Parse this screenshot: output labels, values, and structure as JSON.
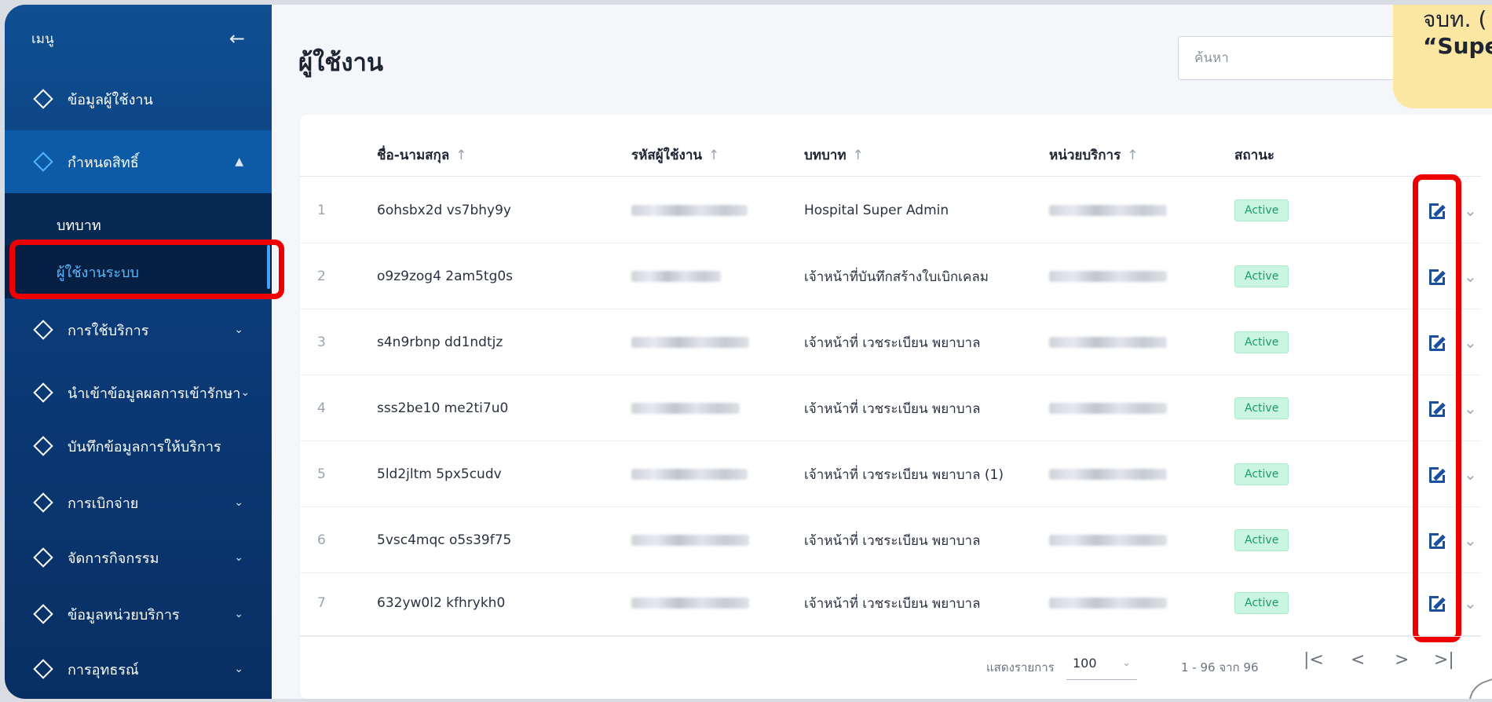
{
  "sidebar": {
    "title": "เมนู",
    "items": [
      {
        "label": "ข้อมูลผู้ใช้งาน",
        "chevron": ""
      },
      {
        "label": "กำหนดสิทธิ์",
        "chevron": "^"
      },
      {
        "label": "บทบาท",
        "chevron": ""
      },
      {
        "label": "ผู้ใช้งานระบบ",
        "chevron": ""
      },
      {
        "label": "การใช้บริการ",
        "chevron": "v"
      },
      {
        "label": "นำเข้าข้อมูลผลการเข้ารักษา",
        "chevron": "v"
      },
      {
        "label": "บันทึกข้อมูลการให้บริการ",
        "chevron": ""
      },
      {
        "label": "การเบิกจ่าย",
        "chevron": "v"
      },
      {
        "label": "จัดการกิจกรรม",
        "chevron": "v"
      },
      {
        "label": "ข้อมูลหน่วยบริการ",
        "chevron": "v"
      },
      {
        "label": "การอุทธรณ์",
        "chevron": "v"
      }
    ]
  },
  "header": {
    "title": "ผู้ใช้งาน",
    "search_placeholder": "ค้นหา",
    "tooltip_line1": "จบท. (",
    "tooltip_line2": "“Supe"
  },
  "table": {
    "columns": [
      "ชื่อ-นามสกุล",
      "รหัสผู้ใช้งาน",
      "บทบาท",
      "หน่วยบริการ",
      "สถานะ"
    ],
    "rows": [
      {
        "num": "1",
        "name": "6ohsbx2d vs7bhy9y",
        "role": "Hospital Super Admin",
        "status": "Active"
      },
      {
        "num": "2",
        "name": "o9z9zog4 2am5tg0s",
        "role": "เจ้าหน้าที่บันทึกสร้างใบเบิกเคลม",
        "status": "Active"
      },
      {
        "num": "3",
        "name": "s4n9rbnp dd1ndtjz",
        "role": "เจ้าหน้าที่ เวชระเบียน พยาบาล",
        "status": "Active"
      },
      {
        "num": "4",
        "name": "sss2be10 me2ti7u0",
        "role": "เจ้าหน้าที่ เวชระเบียน พยาบาล",
        "status": "Active"
      },
      {
        "num": "5",
        "name": "5ld2jltm 5px5cudv",
        "role": "เจ้าหน้าที่ เวชระเบียน พยาบาล (1)",
        "status": "Active"
      },
      {
        "num": "6",
        "name": "5vsc4mqc o5s39f75",
        "role": "เจ้าหน้าที่ เวชระเบียน พยาบาล",
        "status": "Active"
      },
      {
        "num": "7",
        "name": "632yw0l2 kfhrykh0",
        "role": "เจ้าหน้าที่ เวชระเบียน พยาบาล",
        "status": "Active"
      }
    ]
  },
  "footer": {
    "page_size_label": "แสดงรายการ",
    "page_size": "100",
    "range": "1 - 96 จาก 96"
  },
  "colors": {
    "sidebar": "#0b3b78",
    "accent": "#3fa4ff",
    "status_active": "#1c9c64",
    "highlight": "#ee0000"
  }
}
